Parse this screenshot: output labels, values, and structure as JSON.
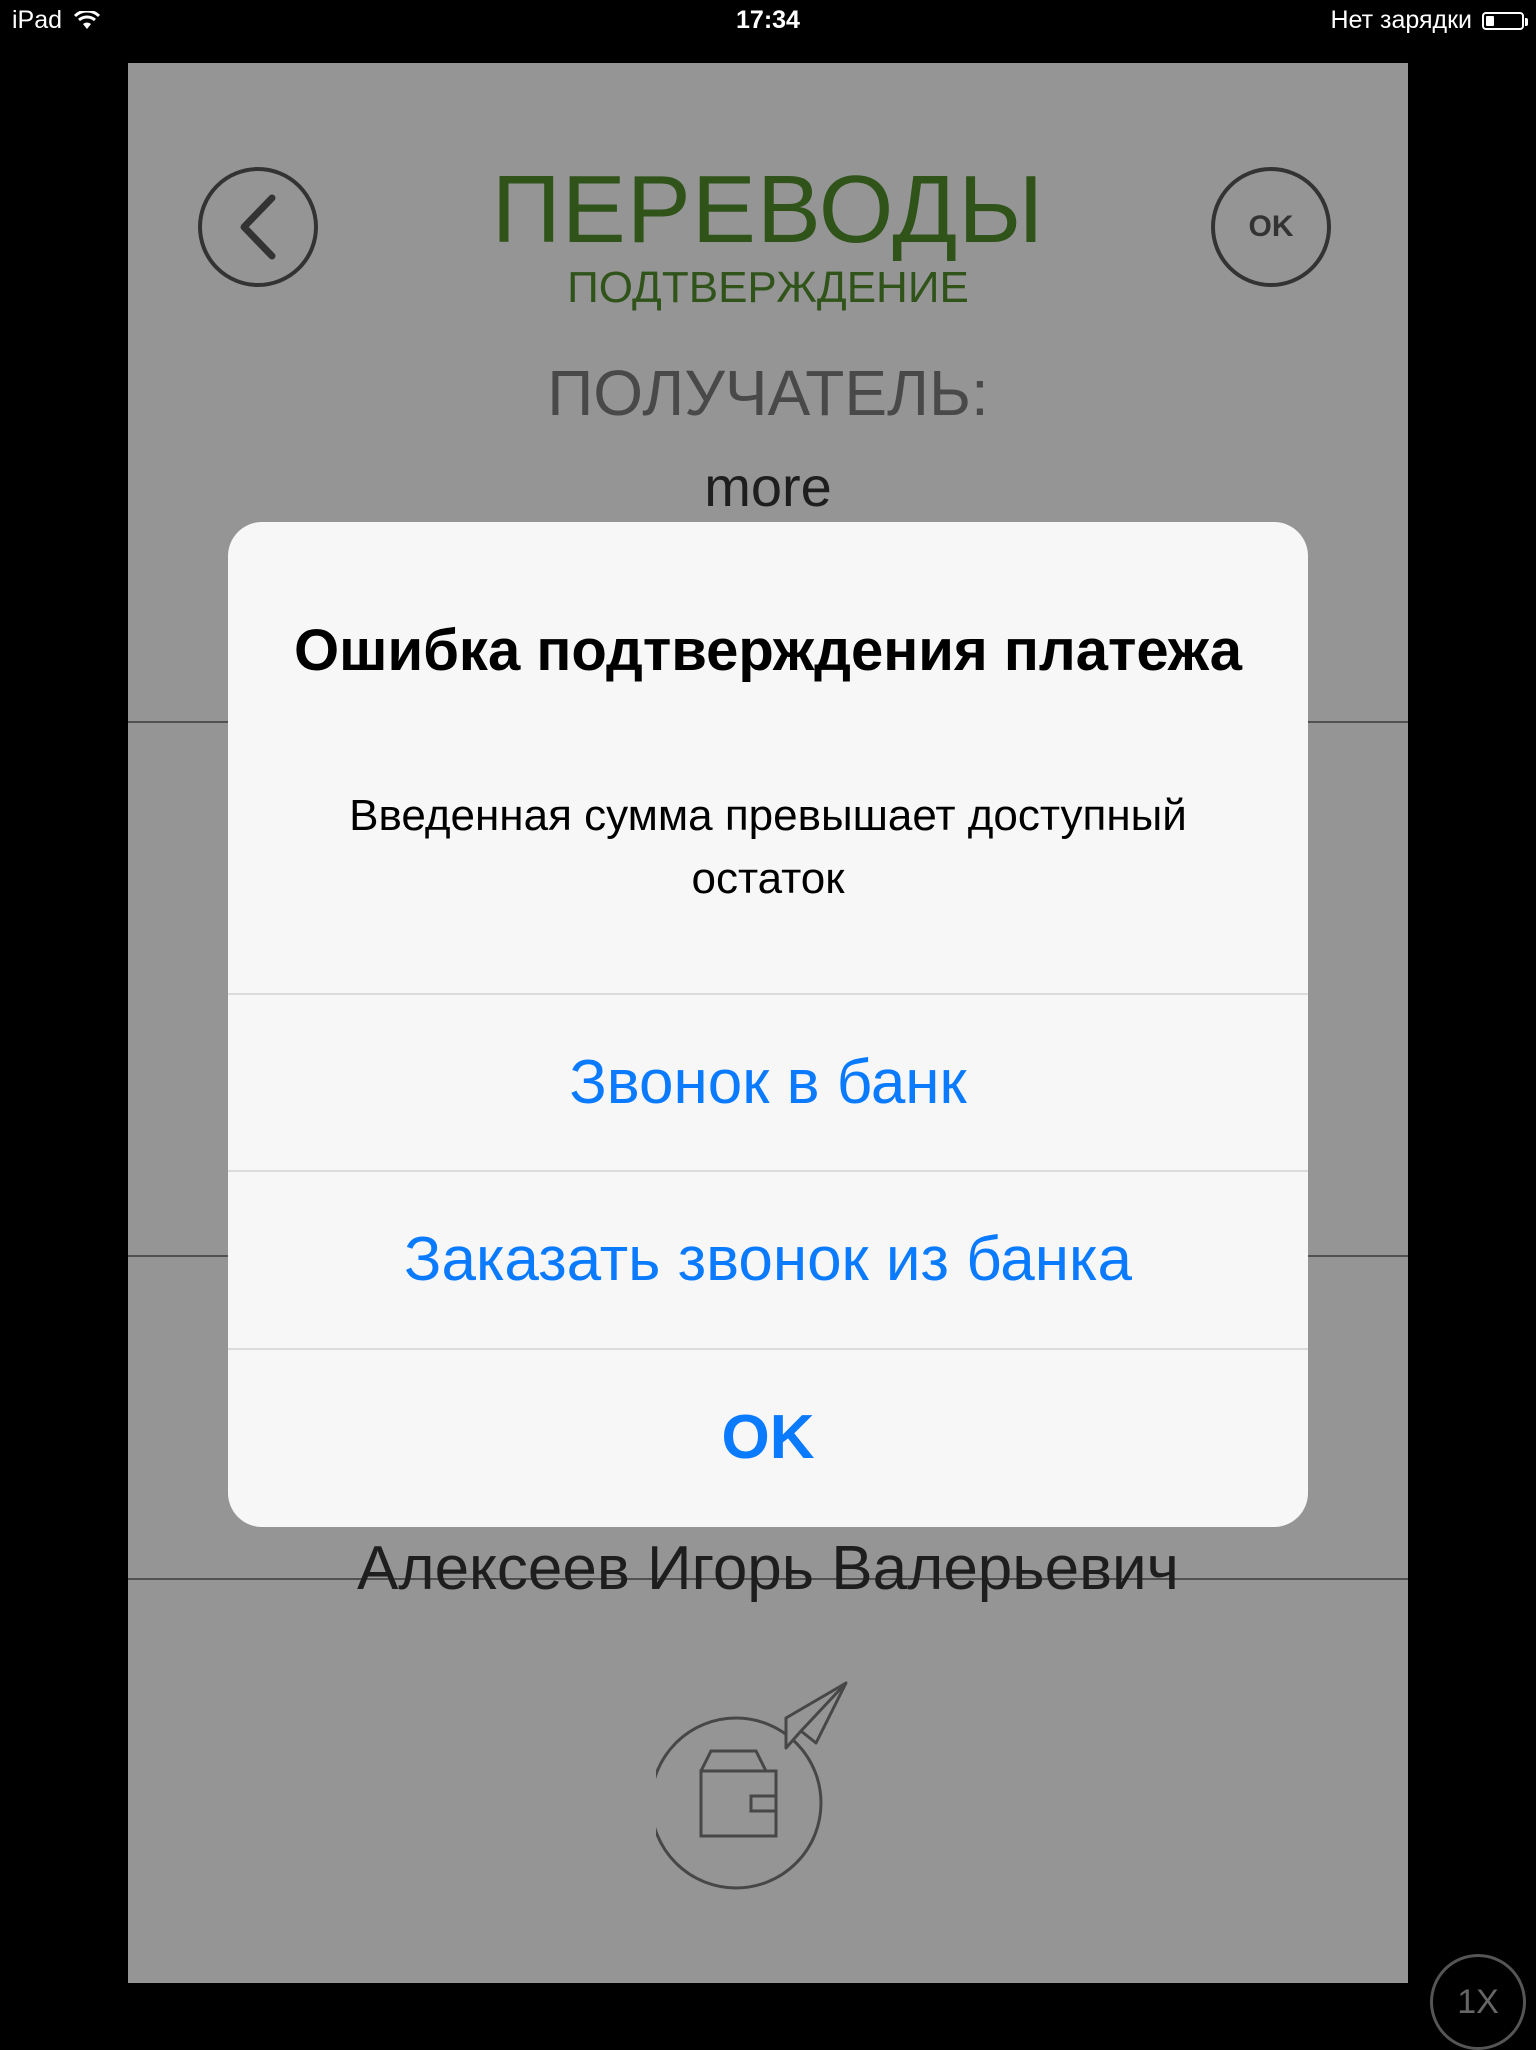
{
  "status_bar": {
    "device": "iPad",
    "time": "17:34",
    "charging_status": "Нет зарядки",
    "wifi_icon": "wifi-icon",
    "battery_level": 0.2
  },
  "screen": {
    "title": "ПЕРЕВОДЫ",
    "subtitle": "ПОДТВЕРЖДЕНИЕ",
    "recipient_label": "ПОЛУЧАТЕЛЬ:",
    "recipient_value": "more",
    "back_icon": "chevron-left-icon",
    "ok_label": "OK",
    "obscured_name": "Алексеев Игорь Валерьевич",
    "send_icon": "wallet-paper-plane-icon"
  },
  "alert": {
    "title": "Ошибка подтверждения платежа",
    "message": "Введенная сумма превышает доступный остаток",
    "buttons": [
      "Звонок в банк",
      "Заказать звонок из банка",
      "OK"
    ]
  },
  "zoom_label": "1X",
  "colors": {
    "brand_green": "#4f8a2b",
    "alert_button_blue": "#0a7aff",
    "overlay": "rgba(0,0,0,0.4)"
  }
}
